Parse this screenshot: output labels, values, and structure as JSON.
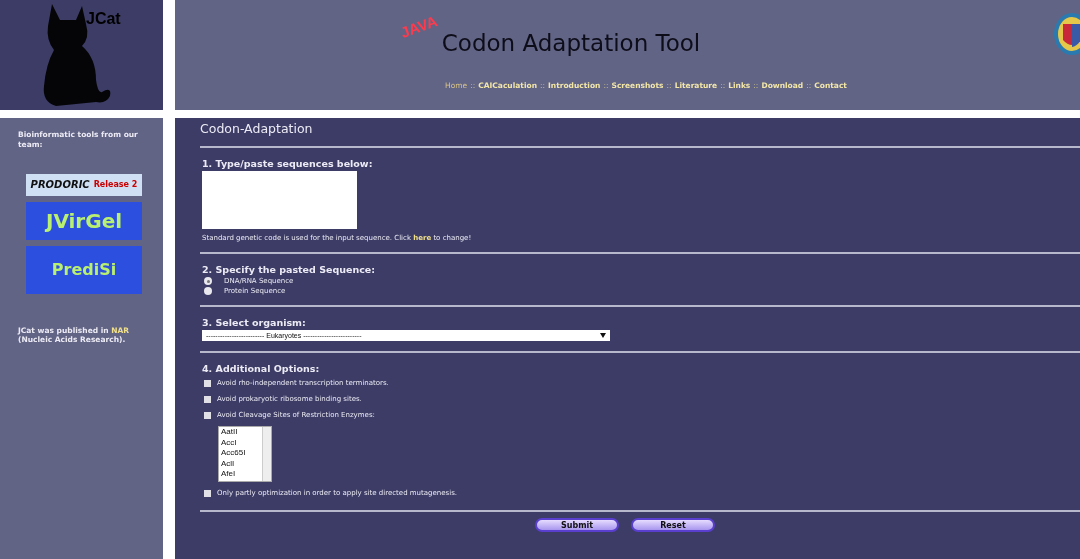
{
  "logo": {
    "text": "JCat"
  },
  "header": {
    "java_badge": "JAVA",
    "title": "Codon Adaptation Tool",
    "nav_separator": "::",
    "nav": [
      {
        "label": "Home",
        "selected": true
      },
      {
        "label": "CAICaculation",
        "selected": false
      },
      {
        "label": "Introduction",
        "selected": false
      },
      {
        "label": "Screenshots",
        "selected": false
      },
      {
        "label": "Literature",
        "selected": false
      },
      {
        "label": "Links",
        "selected": false
      },
      {
        "label": "Download",
        "selected": false
      },
      {
        "label": "Contact",
        "selected": false
      }
    ]
  },
  "sidebar": {
    "intro": "Bioinformatic tools from our team:",
    "tools": [
      {
        "kind": "prodoric",
        "name": "PRODORIC",
        "badge": "Release 2"
      },
      {
        "kind": "jvirgel",
        "name": "JVirGel"
      },
      {
        "kind": "predisi",
        "name": "PrediSi"
      }
    ],
    "publication": {
      "before": "JCat was published in",
      "link": "NAR",
      "after": "(Nucleic Acids Research)."
    }
  },
  "main": {
    "title": "Codon-Adaptation",
    "sequence": {
      "heading": "1. Type/paste sequences below:",
      "note_before": "Standard genetic code is used for the input sequence. Click",
      "note_link": "here",
      "note_after": "to change!"
    },
    "sequence_type": {
      "heading": "2. Specify the pasted Sequence:",
      "options": [
        {
          "label": "DNA/RNA Sequence",
          "selected": true
        },
        {
          "label": "Protein Sequence",
          "selected": false
        }
      ]
    },
    "organism": {
      "heading": "3. Select organism:",
      "value": "------------------------- Eukaryotes -------------------------"
    },
    "options": {
      "heading": "4. Additional Options:",
      "items": [
        {
          "kind": "checkbox",
          "label": "Avoid rho-independent transcription terminators.",
          "checked": false
        },
        {
          "kind": "checkbox",
          "label": "Avoid prokaryotic ribosome binding sites.",
          "checked": false
        },
        {
          "kind": "enzymes",
          "label": "Avoid Cleavage Sites of Restriction Enzymes:",
          "checked": false,
          "enzymes": [
            "AatII",
            "AccI",
            "Acc65I",
            "AclI",
            "AfeI"
          ]
        },
        {
          "kind": "checkbox",
          "label": "Only partly optimization in order to apply site directed mutagenesis.",
          "checked": false
        }
      ]
    },
    "buttons": [
      "Submit",
      "Reset"
    ]
  }
}
